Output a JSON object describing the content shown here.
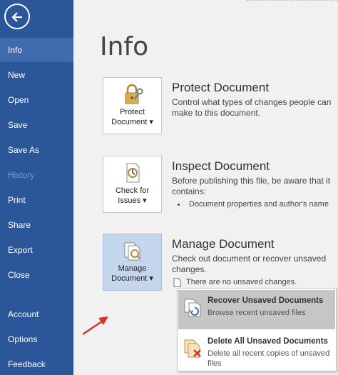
{
  "sidebar": {
    "items": [
      {
        "label": "Info"
      },
      {
        "label": "New"
      },
      {
        "label": "Open"
      },
      {
        "label": "Save"
      },
      {
        "label": "Save As"
      },
      {
        "label": "History"
      },
      {
        "label": "Print"
      },
      {
        "label": "Share"
      },
      {
        "label": "Export"
      },
      {
        "label": "Close"
      },
      {
        "label": "Account"
      },
      {
        "label": "Options"
      },
      {
        "label": "Feedback"
      }
    ],
    "active_item": "Info",
    "background": "#2b579a"
  },
  "page": {
    "title": "Info"
  },
  "sections": {
    "protect": {
      "tile_line1": "Protect",
      "tile_line2": "Document",
      "title": "Protect Document",
      "desc": "Control what types of changes people can make to this document."
    },
    "inspect": {
      "tile_line1": "Check for",
      "tile_line2": "Issues",
      "title": "Inspect Document",
      "desc": "Before publishing this file, be aware that it contains:",
      "bullet": "Document properties and author's name"
    },
    "manage": {
      "tile_line1": "Manage",
      "tile_line2": "Document",
      "title": "Manage Document",
      "desc": "Check out document or recover unsaved changes.",
      "bullet": "There are no unsaved changes."
    }
  },
  "dropdown": {
    "items": [
      {
        "title": "Recover Unsaved Documents",
        "desc": "Browse recent unsaved files",
        "icon": "recover-file-icon"
      },
      {
        "title": "Delete All Unsaved Documents",
        "desc": "Delete all recent copies of unsaved files",
        "icon": "delete-files-icon"
      }
    ]
  },
  "caret": "▾",
  "arrow_color": "#d9342b"
}
